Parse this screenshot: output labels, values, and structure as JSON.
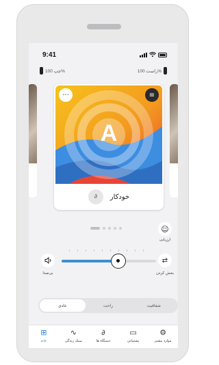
{
  "status_bar": {
    "time": "9:41",
    "icons": [
      "signal-icon",
      "wifi-icon",
      "battery-icon"
    ]
  },
  "hearing_aids": {
    "left_label": "چپ 100%",
    "right_label": "راست 100%"
  },
  "program_card": {
    "letter": "A",
    "name": "خودکار",
    "more_icon": "ellipsis-icon",
    "adjust_icon": "sliders-icon",
    "environment_icon": "ear-icon"
  },
  "carousel": {
    "pages": 5,
    "current": 1
  },
  "feedback": {
    "label": "ارزیابی",
    "icon": "smiley-icon"
  },
  "volume": {
    "label": "بی‌صدا",
    "icon": "speaker-icon",
    "level": 0.6
  },
  "equalizer": {
    "label": "بخش کردن",
    "icon": "tune-icon"
  },
  "segment_control": {
    "options": [
      "عادی",
      "راحت",
      "شفافیت"
    ],
    "selected": 0
  },
  "tab_bar": {
    "items": [
      {
        "label": "خانه",
        "icon": "grid-icon"
      },
      {
        "label": "سبک زندگی",
        "icon": "activity-icon"
      },
      {
        "label": "دستگاه ها",
        "icon": "hearing-aid-icon"
      },
      {
        "label": "پشتیبانی",
        "icon": "chat-icon"
      },
      {
        "label": "موارد بیشتر",
        "icon": "gear-icon"
      }
    ],
    "active": 0
  },
  "colors": {
    "accent": "#2c7fc8",
    "slider_fill": "#3c8fd0"
  }
}
